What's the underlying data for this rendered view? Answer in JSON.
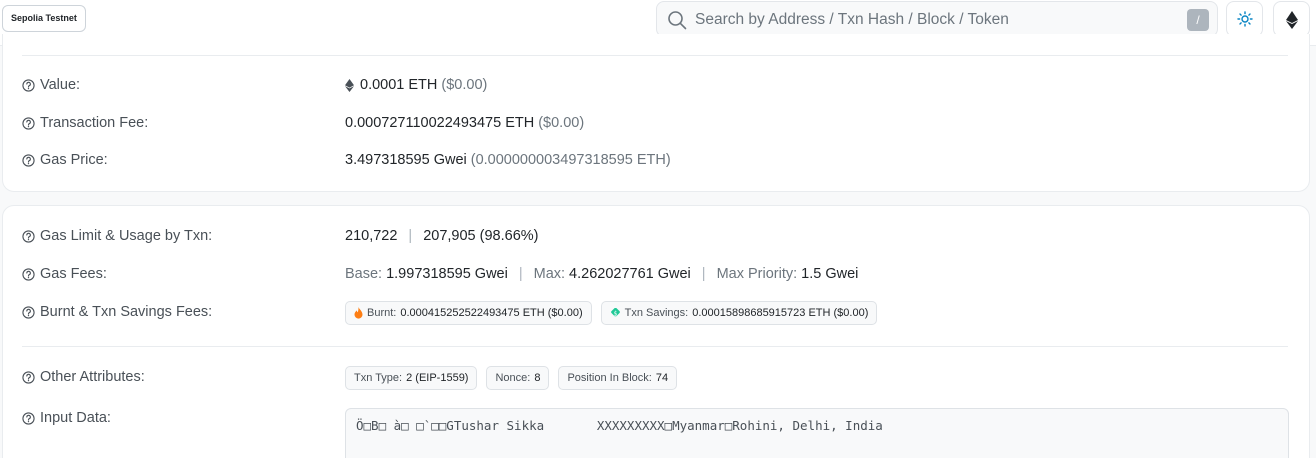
{
  "header": {
    "network": "Sepolia Testnet",
    "search_placeholder": "Search by Address / Txn Hash / Block / Token",
    "search_shortcut": "/"
  },
  "details": {
    "value": {
      "label": "Value:",
      "amount": "0.0001 ETH",
      "usd": "($0.00)"
    },
    "fee": {
      "label": "Transaction Fee:",
      "amount": "0.000727110022493475 ETH",
      "usd": "($0.00)"
    },
    "gas_price": {
      "label": "Gas Price:",
      "amount": "3.497318595 Gwei",
      "eth": "(0.000000003497318595 ETH)"
    }
  },
  "gas": {
    "limit_usage": {
      "label": "Gas Limit & Usage by Txn:",
      "limit": "210,722",
      "separator": "|",
      "usage": "207,905 (98.66%)"
    },
    "fees": {
      "label": "Gas Fees:",
      "base_label": "Base:",
      "base_value": "1.997318595 Gwei",
      "max_label": "Max:",
      "max_value": "4.262027761 Gwei",
      "priority_label": "Max Priority:",
      "priority_value": "1.5 Gwei",
      "separator": "|"
    },
    "burnt_savings": {
      "label": "Burnt & Txn Savings Fees:",
      "burnt_label": "Burnt:",
      "burnt_value": "0.000415252522493475 ETH ($0.00)",
      "savings_label": "Txn Savings:",
      "savings_value": "0.00015898685915723 ETH ($0.00)"
    }
  },
  "attributes": {
    "label": "Other Attributes:",
    "txn_type_label": "Txn Type:",
    "txn_type_value": "2 (EIP-1559)",
    "nonce_label": "Nonce:",
    "nonce_value": "8",
    "position_label": "Position In Block:",
    "position_value": "74"
  },
  "input": {
    "label": "Input Data:",
    "text": "Ö□B□ à□ □`□□GTushar Sikka       XXXXXXXXX□Myanmar□Rohini, Delhi, India"
  },
  "colors": {
    "accent": "#0784c3",
    "eth_icon": "#343a40",
    "burnt_icon": "#fd7e14",
    "savings_icon": "#20c997"
  }
}
